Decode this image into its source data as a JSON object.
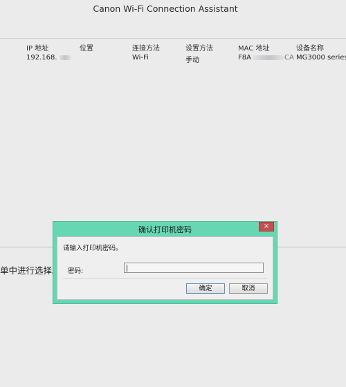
{
  "window": {
    "title": "Canon Wi-Fi Connection Assistant"
  },
  "table": {
    "headers": [
      "IP 地址",
      "位置",
      "连接方法",
      "设置方法",
      "MAC 地址",
      "设备名称"
    ],
    "row": {
      "ip": "192.168.",
      "location": "",
      "connection": "Wi-Fi",
      "setup": "手动",
      "mac": "F8A",
      "mac_tail": "CA",
      "device": "MG3000 series"
    }
  },
  "instruction": "单中进行选择。",
  "dialog": {
    "title": "确认打印机密码",
    "close_icon": "×",
    "prompt": "请输入打印机密码。",
    "password_label": "密码:",
    "password_value": "",
    "ok_label": "确定",
    "cancel_label": "取消"
  },
  "colors": {
    "dialog_frame": "#66d6b3",
    "close_button": "#c74e4e",
    "background": "#ebebeb"
  }
}
